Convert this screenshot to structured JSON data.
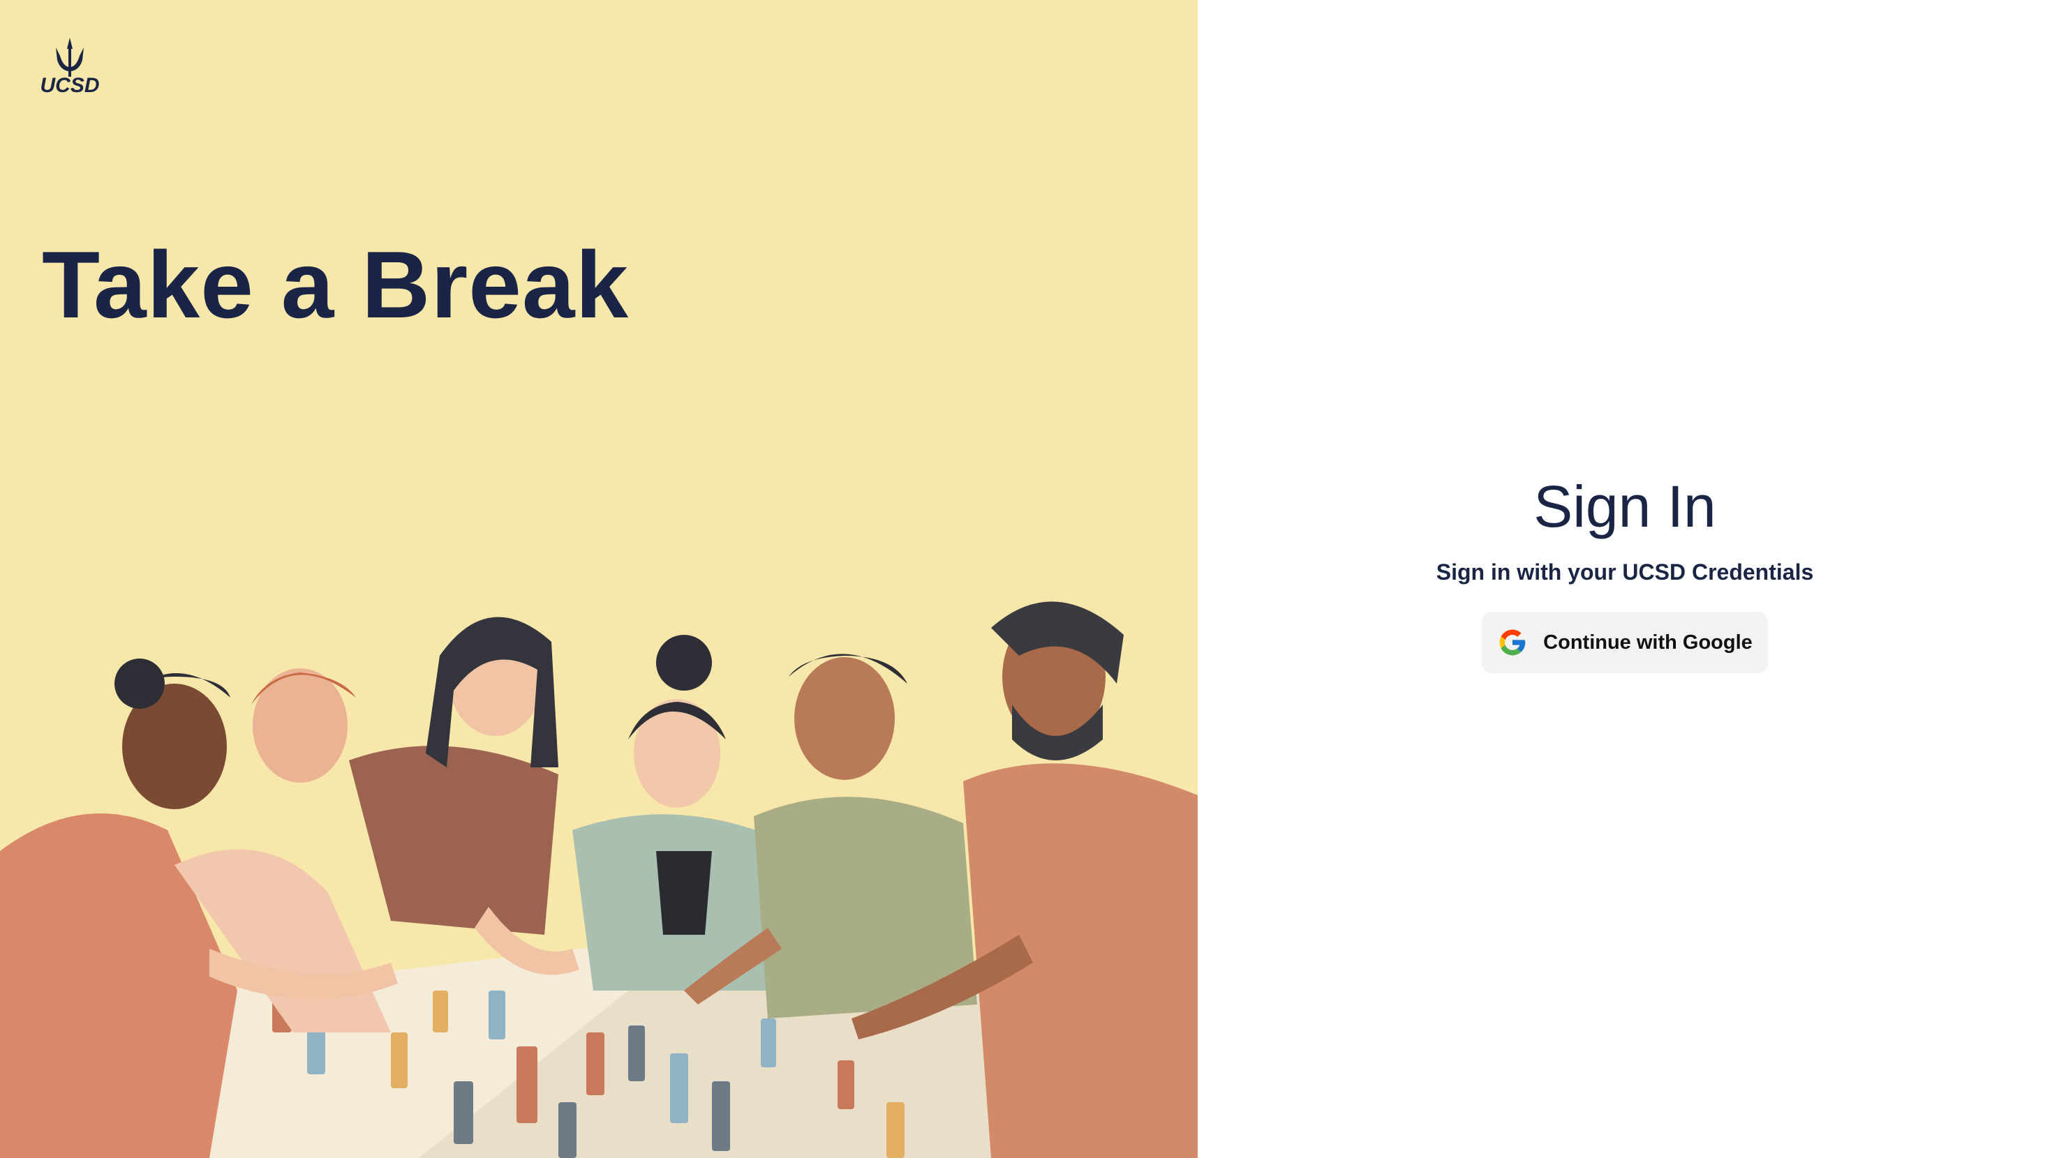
{
  "left": {
    "logo_text": "UCSD",
    "headline": "Take a Break",
    "illustration": "friends-playing-board-game-illustration"
  },
  "signin": {
    "title": "Sign In",
    "subtitle": "Sign in with your UCSD Credentials",
    "google_button_label": "Continue with Google",
    "google_icon": "google-g-icon"
  },
  "colors": {
    "left_background": "#f8e7aa",
    "navy": "#1a2545",
    "button_background": "#f3f3f3"
  }
}
